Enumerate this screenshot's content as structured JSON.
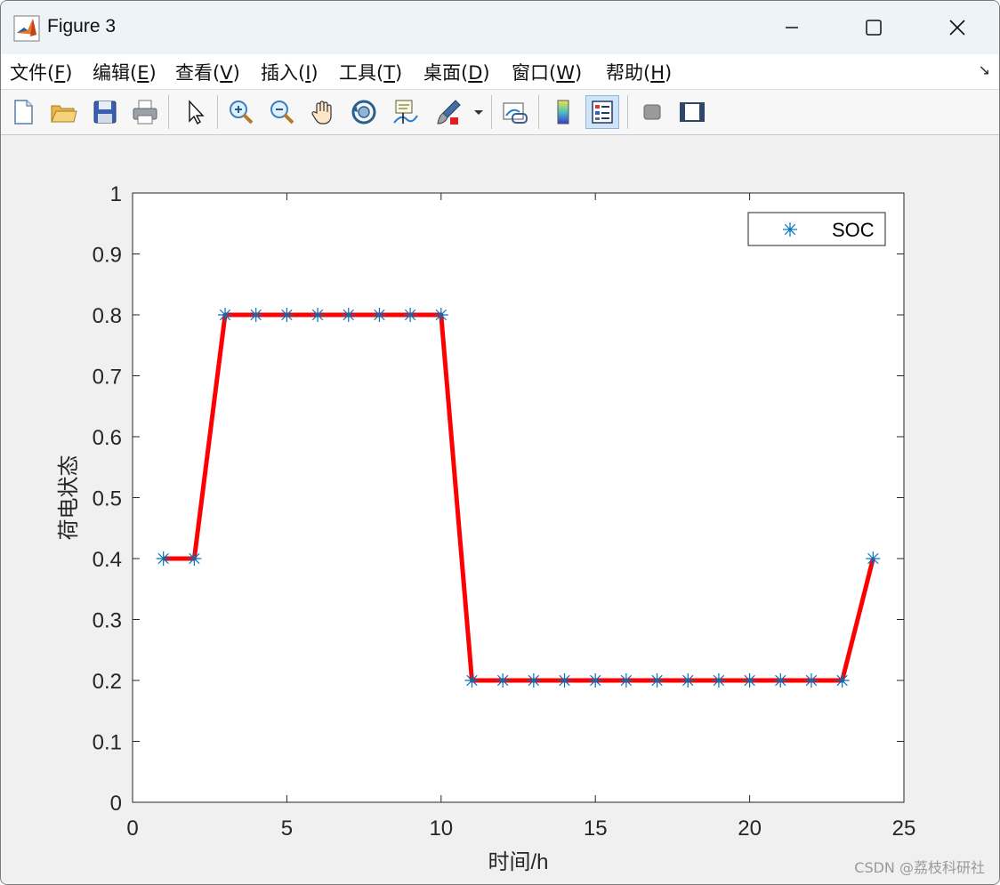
{
  "window": {
    "title": "Figure 3",
    "controls": {
      "minimize": "minimize-icon",
      "maximize": "maximize-icon",
      "close": "close-icon"
    }
  },
  "menu": {
    "items": [
      {
        "label": "文件(",
        "key": "F",
        "suffix": ")"
      },
      {
        "label": "编辑(",
        "key": "E",
        "suffix": ")"
      },
      {
        "label": "查看(",
        "key": "V",
        "suffix": ")"
      },
      {
        "label": "插入(",
        "key": "I",
        "suffix": ")"
      },
      {
        "label": "工具(",
        "key": "T",
        "suffix": ")"
      },
      {
        "label": "桌面(",
        "key": "D",
        "suffix": ")"
      },
      {
        "label": "窗口(",
        "key": "W",
        "suffix": ")"
      },
      {
        "label": "帮助(",
        "key": "H",
        "suffix": ")"
      }
    ]
  },
  "toolbar": {
    "icons": [
      "new-figure-icon",
      "open-file-icon",
      "save-icon",
      "print-icon",
      "select-pointer-icon",
      "zoom-in-icon",
      "zoom-out-icon",
      "pan-hand-icon",
      "rotate-3d-icon",
      "data-cursor-icon",
      "brush-icon",
      "brush-dropdown-icon",
      "link-plot-icon",
      "colorbar-icon",
      "legend-icon",
      "hide-plot-tools-icon",
      "show-plot-tools-icon"
    ],
    "active": "legend-icon"
  },
  "chart_data": {
    "type": "line",
    "title": "",
    "xlabel": "时间/h",
    "ylabel": "荷电状态",
    "xlim": [
      0,
      25
    ],
    "ylim": [
      0,
      1
    ],
    "xticks": [
      0,
      5,
      10,
      15,
      20,
      25
    ],
    "yticks": [
      0,
      0.1,
      0.2,
      0.3,
      0.4,
      0.5,
      0.6,
      0.7,
      0.8,
      0.9,
      1
    ],
    "grid": false,
    "legend": {
      "placement": "top-right",
      "entries": [
        "SOC"
      ]
    },
    "x": [
      1,
      2,
      3,
      4,
      5,
      6,
      7,
      8,
      9,
      10,
      11,
      12,
      13,
      14,
      15,
      16,
      17,
      18,
      19,
      20,
      21,
      22,
      23,
      24
    ],
    "series": [
      {
        "name": "SOC",
        "marker": "asterisk",
        "marker_color": "#0072bd",
        "line_color": "#ff0000",
        "values": [
          0.4,
          0.4,
          0.8,
          0.8,
          0.8,
          0.8,
          0.8,
          0.8,
          0.8,
          0.8,
          0.2,
          0.2,
          0.2,
          0.2,
          0.2,
          0.2,
          0.2,
          0.2,
          0.2,
          0.2,
          0.2,
          0.2,
          0.2,
          0.4
        ]
      }
    ]
  },
  "watermark": "CSDN @荔枝科研社"
}
